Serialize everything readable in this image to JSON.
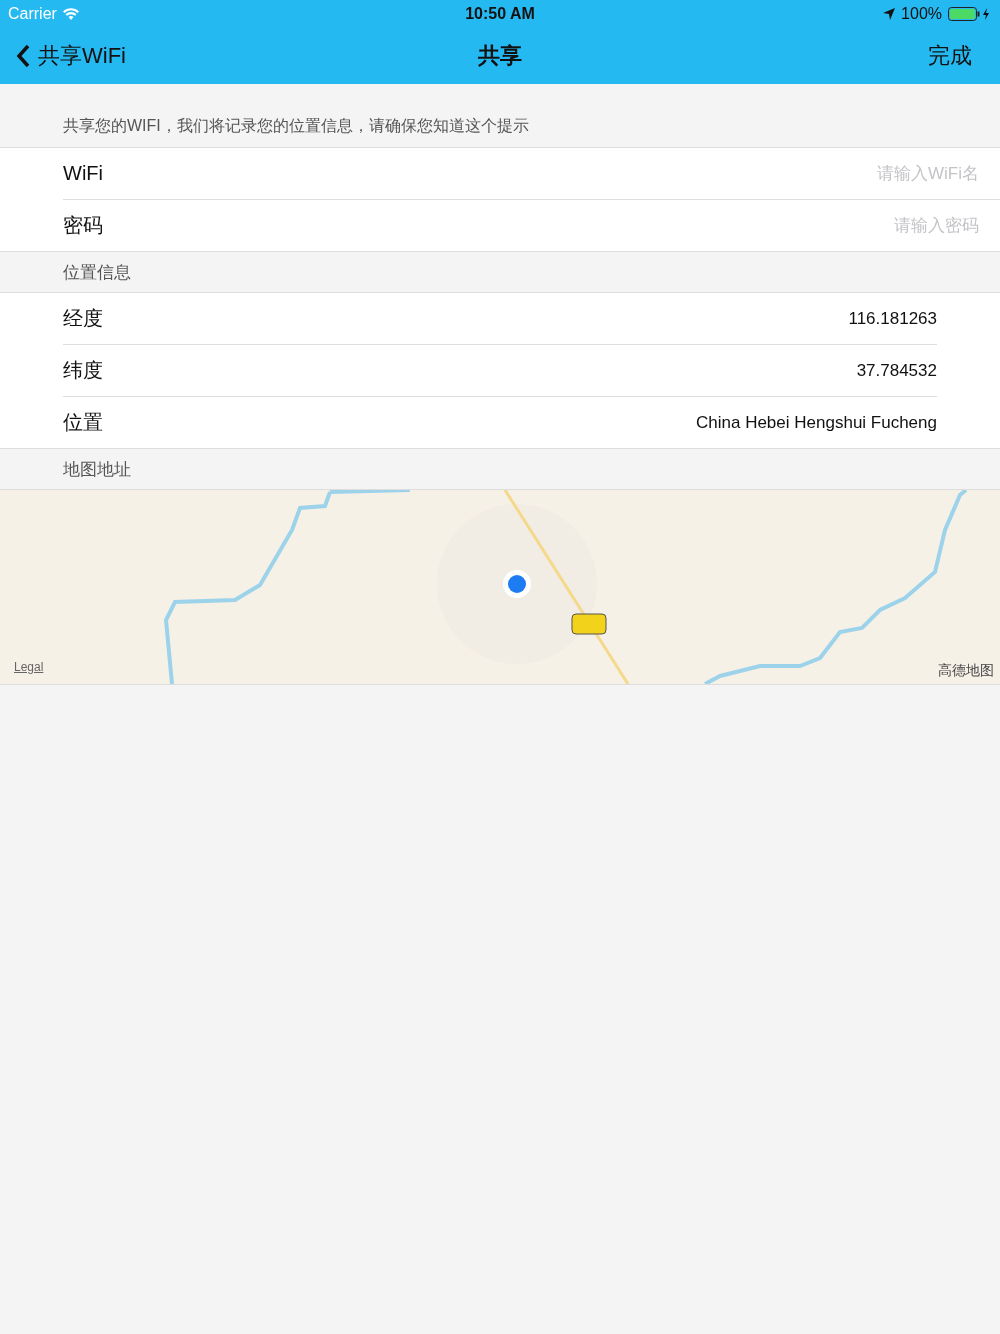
{
  "status_bar": {
    "carrier": "Carrier",
    "time": "10:50 AM",
    "battery": "100%"
  },
  "nav": {
    "back": "共享WiFi",
    "title": "共享",
    "done": "完成"
  },
  "note": "共享您的WIFI，我们将记录您的位置信息，请确保您知道这个提示",
  "fields": [
    {
      "label": "WiFi",
      "placeholder": "请输入WiFi名"
    },
    {
      "label": "密码",
      "placeholder": "请输入密码"
    }
  ],
  "location_section": {
    "title": "位置信息",
    "rows": [
      {
        "label": "经度",
        "value": "116.181263"
      },
      {
        "label": "纬度",
        "value": "37.784532"
      },
      {
        "label": "位置",
        "value": "China Hebei Hengshui Fucheng"
      }
    ]
  },
  "map_section": {
    "title": "地图地址",
    "map": {
      "kind": "picture",
      "legal": "Legal",
      "provider": "高德地图"
    }
  }
}
